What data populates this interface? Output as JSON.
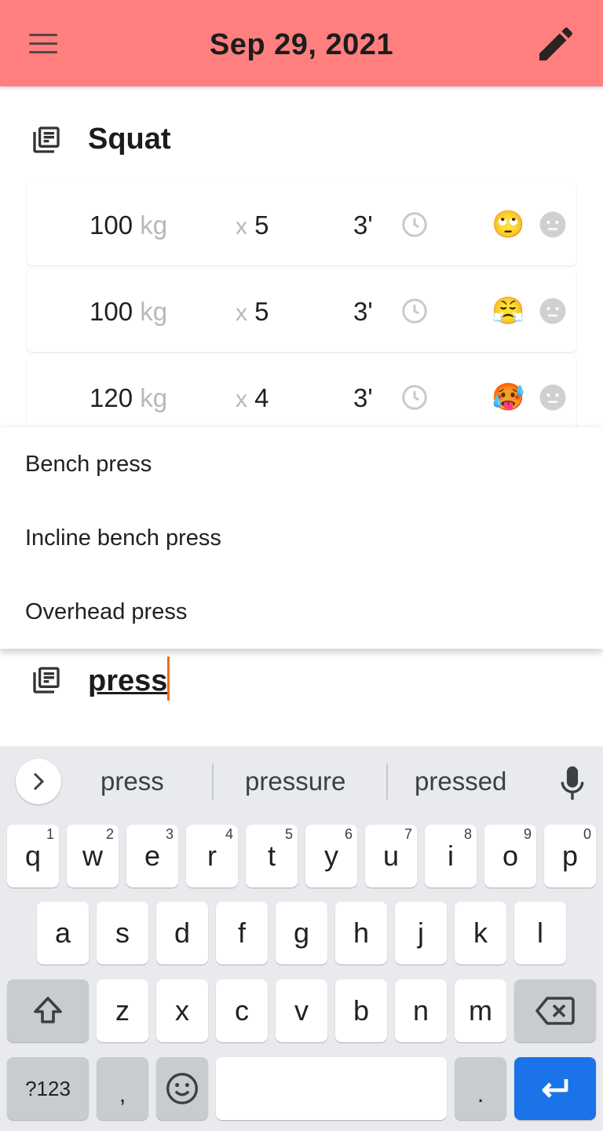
{
  "app": {
    "date_title": "Sep 29, 2021"
  },
  "icons": {
    "menu": "hamburger-menu-icon",
    "edit": "pencil-icon",
    "exercise": "library-books-icon",
    "rest": "clock-icon",
    "feeling": "neutral-face-icon"
  },
  "colors": {
    "appbar": "#ff7f7f",
    "caret": "#f26a1b",
    "enter_key": "#1a73e8"
  },
  "exercise": {
    "name": "Squat",
    "sets": [
      {
        "weight": "100",
        "unit": "kg",
        "x": "x",
        "reps": "5",
        "rest": "3'",
        "emoji": "🙄"
      },
      {
        "weight": "100",
        "unit": "kg",
        "x": "x",
        "reps": "5",
        "rest": "3'",
        "emoji": "😤"
      },
      {
        "weight": "120",
        "unit": "kg",
        "x": "x",
        "reps": "4",
        "rest": "3'",
        "emoji": "🥵"
      }
    ]
  },
  "dropdown": {
    "options": [
      "Bench press",
      "Incline bench press",
      "Overhead press"
    ]
  },
  "new_exercise": {
    "value": "press"
  },
  "keyboard": {
    "suggestions": [
      "press",
      "pressure",
      "pressed"
    ],
    "row1": [
      "q",
      "w",
      "e",
      "r",
      "t",
      "y",
      "u",
      "i",
      "o",
      "p"
    ],
    "row1_hints": [
      "1",
      "2",
      "3",
      "4",
      "5",
      "6",
      "7",
      "8",
      "9",
      "0"
    ],
    "row2": [
      "a",
      "s",
      "d",
      "f",
      "g",
      "h",
      "j",
      "k",
      "l"
    ],
    "row3": [
      "z",
      "x",
      "c",
      "v",
      "b",
      "n",
      "m"
    ],
    "symbols_label": "?123",
    "comma": ",",
    "period": "."
  }
}
